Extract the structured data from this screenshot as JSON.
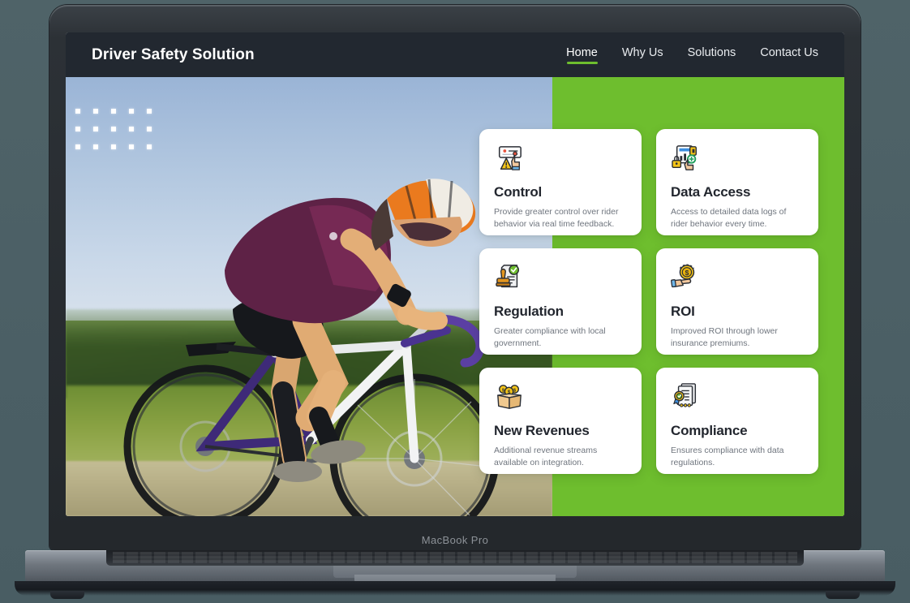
{
  "device": {
    "model_label": "MacBook Pro",
    "camera_icon": "camera-dot-icon"
  },
  "colors": {
    "accent_green": "#6ebe2e",
    "navbar_bg": "#222830",
    "page_bg": "#4e6369",
    "card_bg": "#ffffff",
    "title_text": "#22262e",
    "body_text": "#6f757e"
  },
  "site": {
    "brand": "Driver Safety Solution",
    "nav": [
      {
        "label": "Home",
        "active": true
      },
      {
        "label": "Why Us",
        "active": false
      },
      {
        "label": "Solutions",
        "active": false
      },
      {
        "label": "Contact Us",
        "active": false
      }
    ],
    "hero": {
      "photo_alt": "cyclist riding road bike on gravel path",
      "decor_icon": "dot-grid-decoration"
    },
    "cards": [
      {
        "icon": "alert-screen-hand-icon",
        "title": "Control",
        "desc": "Provide greater control over rider behavior via real time feedback."
      },
      {
        "icon": "data-lock-document-icon",
        "title": "Data Access",
        "desc": "Access to detailed data logs of rider behavior every time."
      },
      {
        "icon": "stamp-approved-document-icon",
        "title": "Regulation",
        "desc": "Greater compliance with local government."
      },
      {
        "icon": "hand-holding-coin-icon",
        "title": "ROI",
        "desc": "Improved ROI through lower insurance premiums."
      },
      {
        "icon": "box-of-coins-icon",
        "title": "New Revenues",
        "desc": "Additional revenue streams available on integration."
      },
      {
        "icon": "certified-document-badge-icon",
        "title": "Compliance",
        "desc": "Ensures compliance with data regulations."
      }
    ]
  }
}
